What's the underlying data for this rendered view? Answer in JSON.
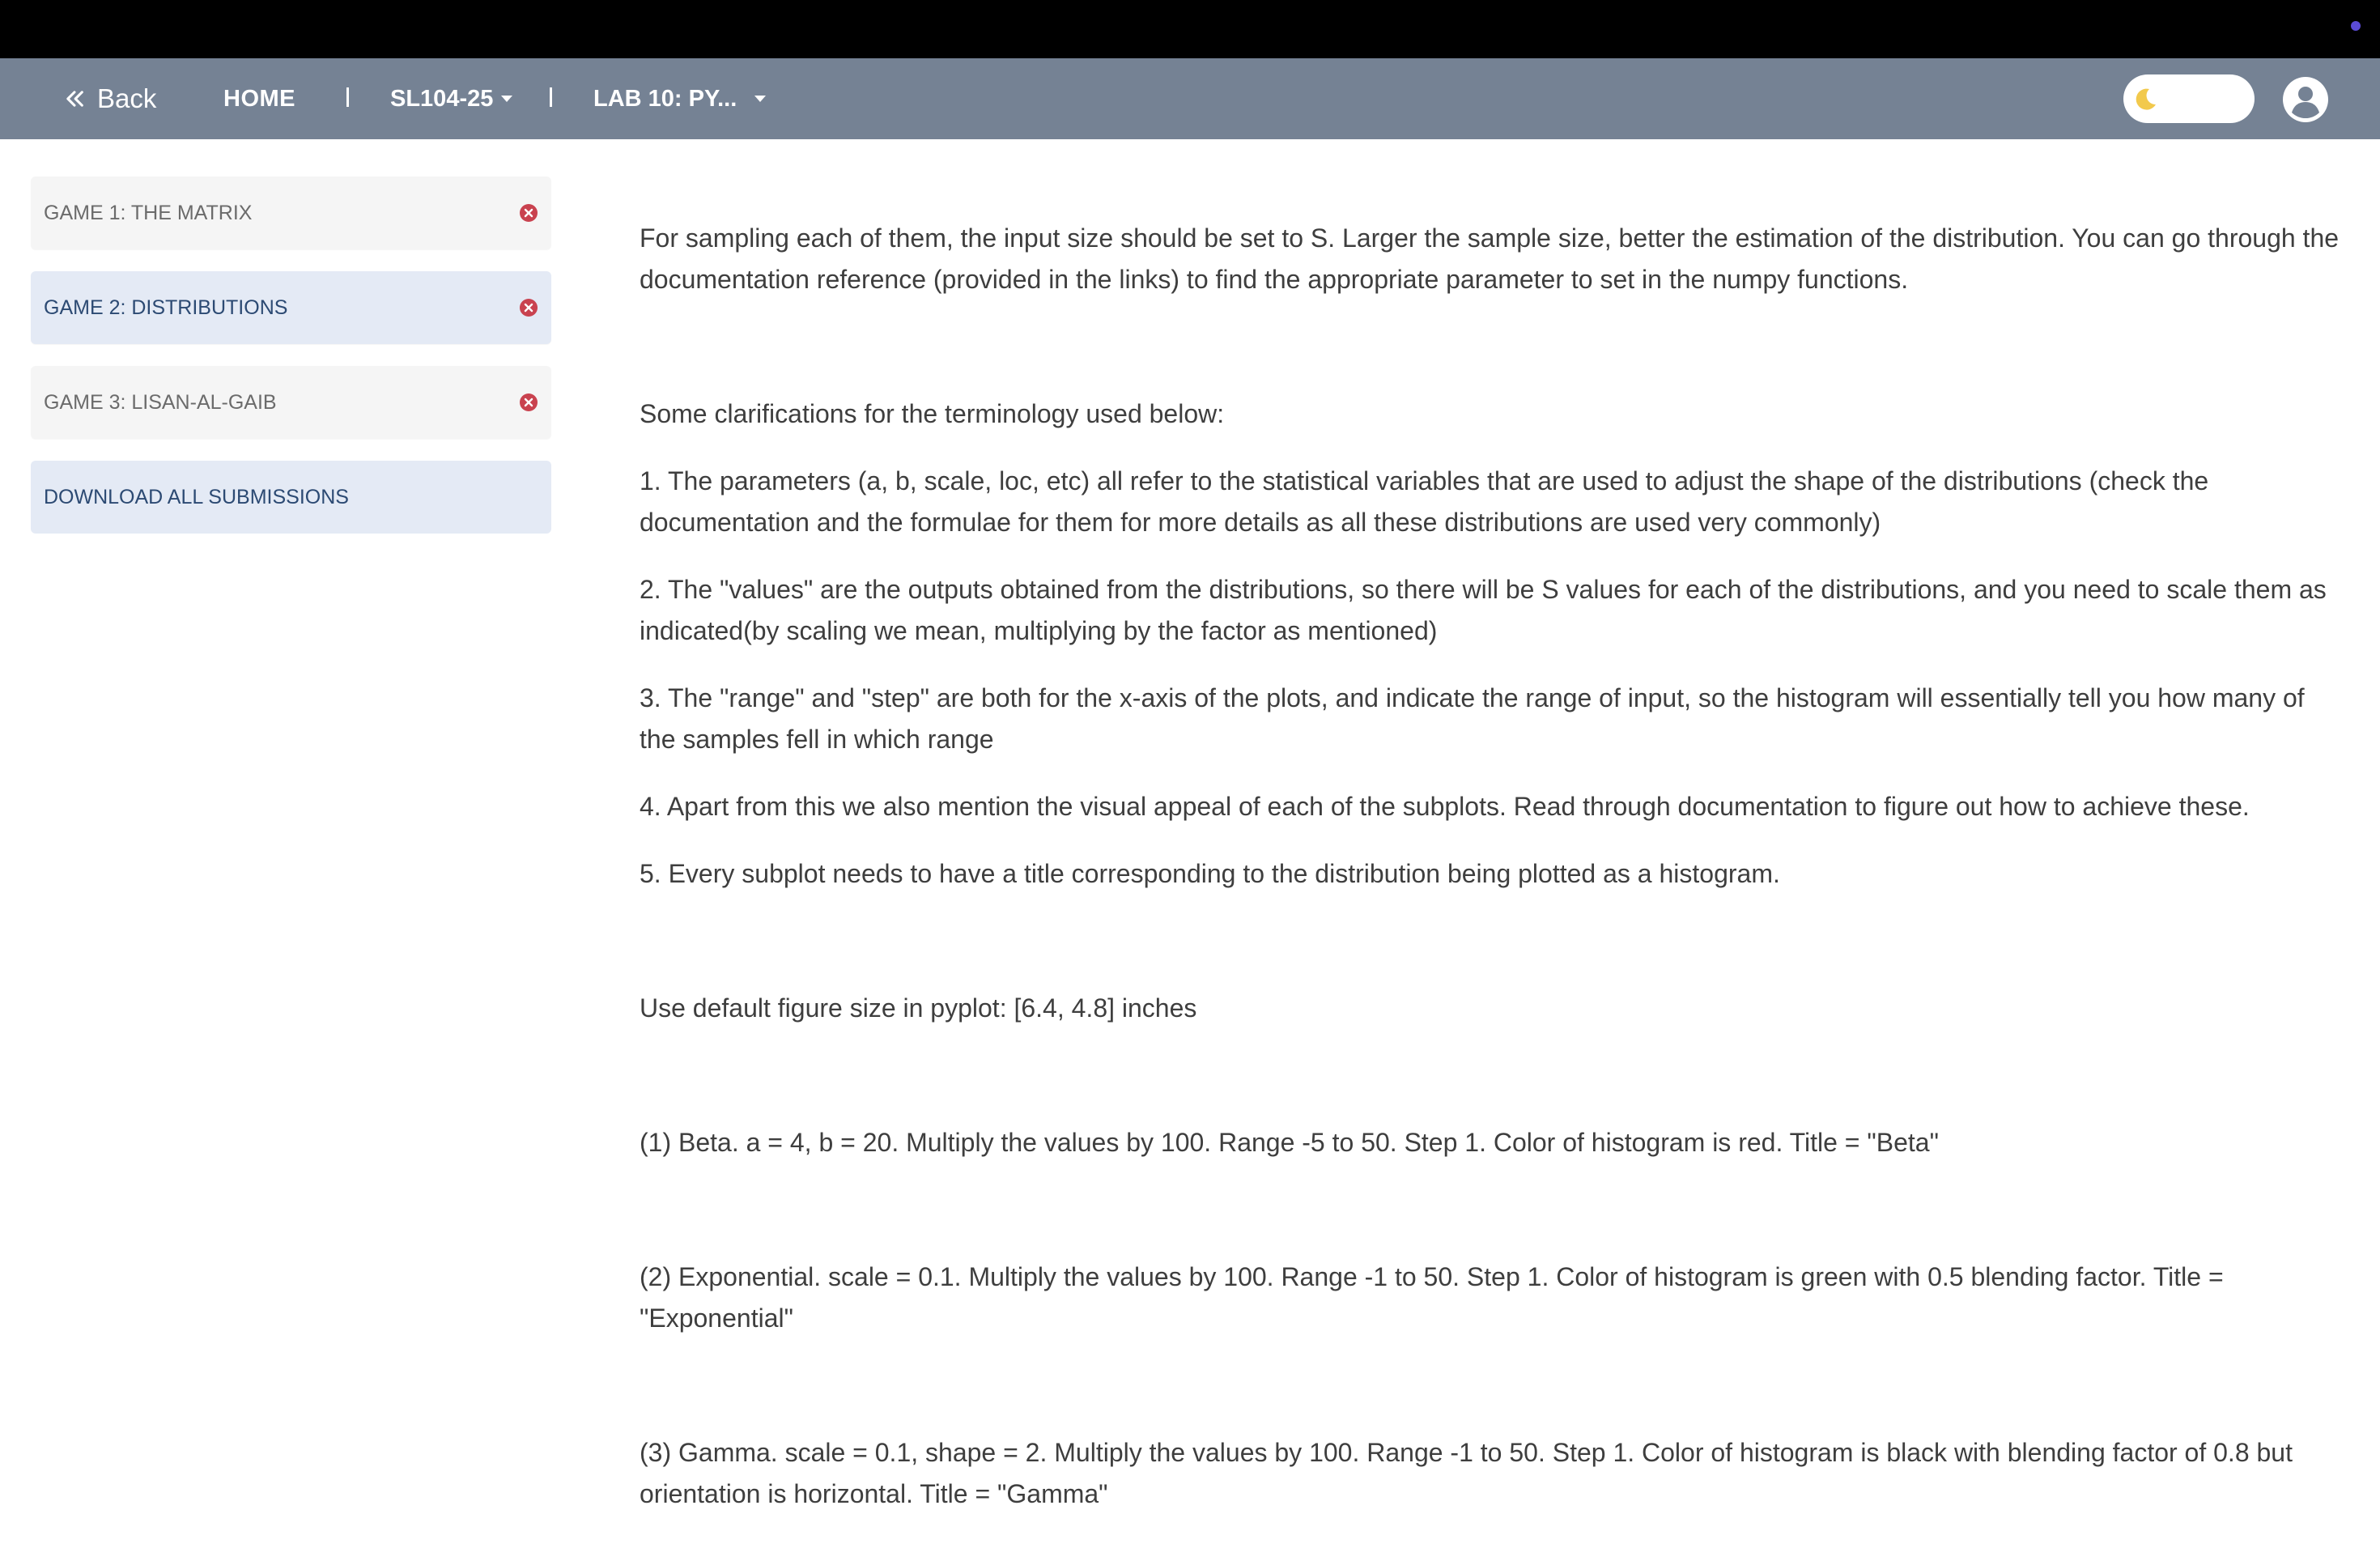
{
  "navbar": {
    "back_label": "Back",
    "home_label": "HOME",
    "course_label": "SL104-25",
    "lab_label": "LAB 10: PY..."
  },
  "sidebar": {
    "items": [
      {
        "label": "GAME 1: THE MATRIX",
        "active": false
      },
      {
        "label": "GAME 2: DISTRIBUTIONS",
        "active": true
      },
      {
        "label": "GAME 3: LISAN-AL-GAIB",
        "active": false
      }
    ],
    "download_label": "DOWNLOAD ALL SUBMISSIONS"
  },
  "content": {
    "intro": "For sampling each of them, the input size should be set to S. Larger the sample size, better the estimation of the distribution. You can go through the documentation reference (provided in the links) to find the appropriate parameter to set in the numpy functions.",
    "clarifications_heading": "Some clarifications for the terminology used below:",
    "clarifications": [
      "1. The parameters (a, b, scale, loc, etc) all refer to the statistical variables that are used to adjust the shape of the distributions (check the documentation and the formulae for them for more details as all these distributions are used very commonly)",
      "2. The \"values\" are the outputs obtained from the distributions, so there will be S values for each of the distributions, and you need to scale them as indicated(by scaling we mean, multiplying by the factor as mentioned)",
      "3. The \"range\" and \"step\" are both for the x-axis of the plots, and indicate the range of input, so the histogram will essentially tell you how many of the samples fell in which range",
      "4. Apart from this we also mention the visual appeal of each of the subplots. Read through documentation to figure out how to achieve these.",
      "5. Every subplot needs to have a title corresponding to the distribution being plotted as a histogram."
    ],
    "figsize_note": "Use default figure size in pyplot: [6.4, 4.8] inches",
    "tasks": [
      "(1) Beta. a = 4, b = 20. Multiply the values by 100. Range -5 to 50. Step 1. Color of histogram is red. Title = \"Beta\"",
      "(2) Exponential. scale = 0.1. Multiply the values by 100. Range -1 to 50. Step 1. Color of histogram is green with 0.5 blending factor. Title = \"Exponential\"",
      "(3) Gamma. scale = 0.1, shape = 2. Multiply the values by 100. Range -1 to 50. Step 1. Color of histogram is black with blending factor of 0.8 but orientation is horizontal. Title = \"Gamma\""
    ]
  },
  "colors": {
    "navbar_bg": "#758294",
    "active_item_bg": "#e4eaf5",
    "close_icon": "#c9424f",
    "moon_icon": "#f2c94c"
  }
}
